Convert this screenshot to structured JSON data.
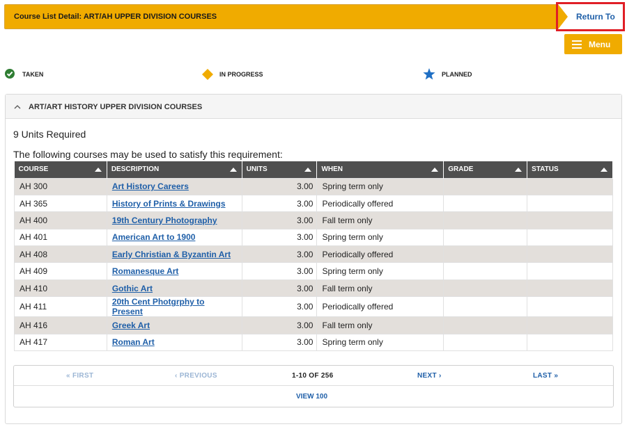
{
  "header": {
    "title": "Course List Detail:  ART/AH UPPER DIVISION COURSES",
    "return_label": "Return To",
    "menu_label": "Menu"
  },
  "legend": {
    "taken": "TAKEN",
    "in_progress": "IN PROGRESS",
    "planned": "PLANNED",
    "colors": {
      "taken": "#2e7d32",
      "in_progress": "#f0ab00",
      "planned": "#1f6fc4"
    }
  },
  "panel": {
    "heading": "ART/ART HISTORY UPPER DIVISION COURSES",
    "units_required": "9 Units Required",
    "instruction": "The following courses may be used to satisfy this requirement:"
  },
  "table": {
    "columns": [
      "COURSE",
      "DESCRIPTION",
      "UNITS",
      "WHEN",
      "GRADE",
      "STATUS"
    ],
    "rows": [
      {
        "course": "AH 300",
        "description": "Art History Careers",
        "units": "3.00",
        "when": "Spring term only",
        "grade": "",
        "status": ""
      },
      {
        "course": "AH 365",
        "description": "History of Prints & Drawings",
        "units": "3.00",
        "when": "Periodically offered",
        "grade": "",
        "status": ""
      },
      {
        "course": "AH 400",
        "description": "19th Century Photography",
        "units": "3.00",
        "when": "Fall term only",
        "grade": "",
        "status": ""
      },
      {
        "course": "AH 401",
        "description": "American Art to 1900",
        "units": "3.00",
        "when": "Spring term only",
        "grade": "",
        "status": ""
      },
      {
        "course": "AH 408",
        "description": "Early Christian & Byzantin Art",
        "units": "3.00",
        "when": "Periodically offered",
        "grade": "",
        "status": ""
      },
      {
        "course": "AH 409",
        "description": "Romanesque Art",
        "units": "3.00",
        "when": "Spring term only",
        "grade": "",
        "status": ""
      },
      {
        "course": "AH 410",
        "description": "Gothic Art",
        "units": "3.00",
        "when": "Fall term only",
        "grade": "",
        "status": ""
      },
      {
        "course": "AH 411",
        "description": "20th Cent Photgrphy to Present",
        "units": "3.00",
        "when": "Periodically offered",
        "grade": "",
        "status": ""
      },
      {
        "course": "AH 416",
        "description": "Greek Art",
        "units": "3.00",
        "when": "Fall term only",
        "grade": "",
        "status": ""
      },
      {
        "course": "AH 417",
        "description": "Roman Art",
        "units": "3.00",
        "when": "Spring term only",
        "grade": "",
        "status": ""
      }
    ]
  },
  "pager": {
    "first": "« FIRST",
    "previous": "‹ PREVIOUS",
    "range": "1-10 OF 256",
    "next": "NEXT ›",
    "last": "LAST »",
    "view_all": "VIEW 100"
  }
}
